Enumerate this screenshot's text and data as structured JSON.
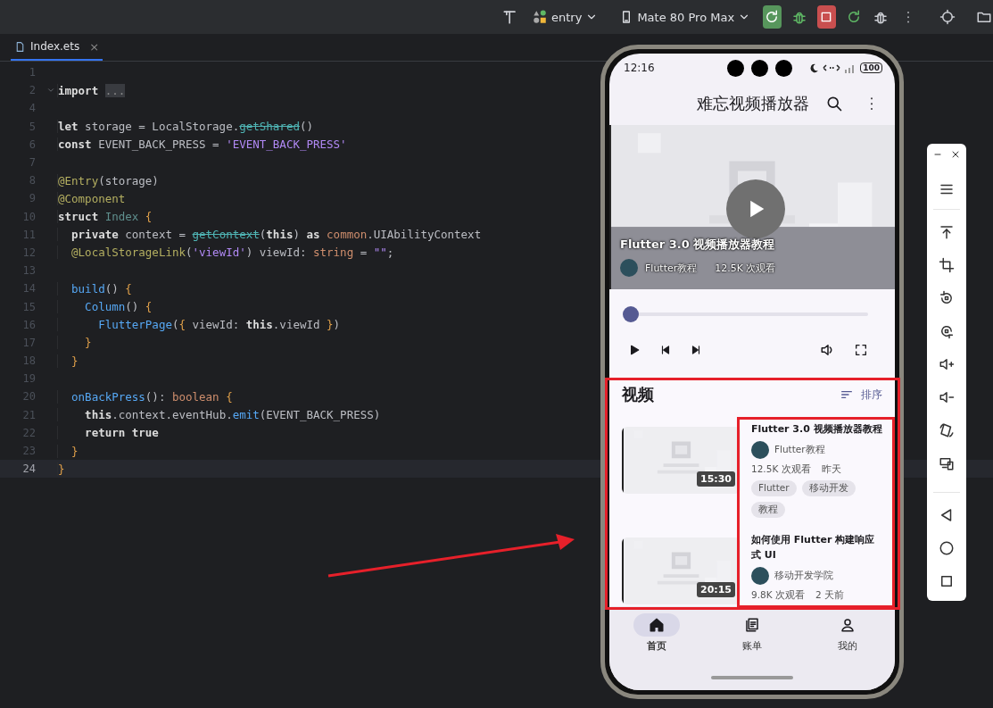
{
  "toolbar": {
    "run_config": "entry",
    "device": "Mate 80 Pro Max"
  },
  "editor_tab": {
    "label": "Index.ets",
    "close": "×"
  },
  "code_lines": [
    {
      "number": "1",
      "fold": false,
      "current": false
    },
    {
      "number": "2",
      "fold": true,
      "current": false,
      "segments": [
        {
          "kind": "kw",
          "text": "import "
        },
        {
          "kind": "folded",
          "text": "..."
        }
      ]
    },
    {
      "number": "4",
      "fold": false,
      "current": false
    },
    {
      "number": "5",
      "fold": false,
      "current": false,
      "segments": [
        {
          "kind": "kw",
          "text": "let"
        },
        {
          "kind": "plain",
          "text": " storage = LocalStorage."
        },
        {
          "kind": "deprecated",
          "text": "getShared"
        },
        {
          "kind": "plain",
          "text": "()"
        }
      ]
    },
    {
      "number": "6",
      "fold": false,
      "current": false,
      "segments": [
        {
          "kind": "kw",
          "text": "const"
        },
        {
          "kind": "plain",
          "text": " EVENT_BACK_PRESS = "
        },
        {
          "kind": "str",
          "text": "'EVENT_BACK_PRESS'"
        }
      ]
    },
    {
      "number": "7",
      "fold": false,
      "current": false
    },
    {
      "number": "8",
      "fold": false,
      "current": false,
      "segments": [
        {
          "kind": "dec",
          "text": "@Entry"
        },
        {
          "kind": "plain",
          "text": "(storage)"
        }
      ]
    },
    {
      "number": "9",
      "fold": false,
      "current": false,
      "segments": [
        {
          "kind": "dec",
          "text": "@Component"
        }
      ]
    },
    {
      "number": "10",
      "fold": false,
      "current": false,
      "segments": [
        {
          "kind": "kw",
          "text": "struct "
        },
        {
          "kind": "type",
          "text": "Index"
        },
        {
          "kind": "brace",
          "text": " {"
        }
      ]
    },
    {
      "number": "11",
      "fold": false,
      "current": false,
      "segments": [
        {
          "kind": "kw",
          "text": "  private"
        },
        {
          "kind": "plain",
          "text": " context = "
        },
        {
          "kind": "deprecated",
          "text": "getContext"
        },
        {
          "kind": "plain",
          "text": "("
        },
        {
          "kind": "kw",
          "text": "this"
        },
        {
          "kind": "plain",
          "text": ") "
        },
        {
          "kind": "kw",
          "text": "as "
        },
        {
          "kind": "type2",
          "text": "common"
        },
        {
          "kind": "plain",
          "text": ".UIAbilityContext"
        }
      ]
    },
    {
      "number": "12",
      "fold": false,
      "current": false,
      "segments": [
        {
          "kind": "dec",
          "text": "  @LocalStorageLink"
        },
        {
          "kind": "plain",
          "text": "("
        },
        {
          "kind": "str",
          "text": "'viewId'"
        },
        {
          "kind": "plain",
          "text": ") viewId: "
        },
        {
          "kind": "type2",
          "text": "string"
        },
        {
          "kind": "plain",
          "text": " = "
        },
        {
          "kind": "str",
          "text": "\"\""
        },
        {
          "kind": "plain",
          "text": ";"
        }
      ]
    },
    {
      "number": "13",
      "fold": false,
      "current": false
    },
    {
      "number": "14",
      "fold": false,
      "current": false,
      "segments": [
        {
          "kind": "func",
          "text": "  build"
        },
        {
          "kind": "plain",
          "text": "() "
        },
        {
          "kind": "brace",
          "text": "{"
        }
      ]
    },
    {
      "number": "15",
      "fold": false,
      "current": false,
      "segments": [
        {
          "kind": "func",
          "text": "    Column"
        },
        {
          "kind": "plain",
          "text": "() "
        },
        {
          "kind": "brace",
          "text": "{"
        }
      ]
    },
    {
      "number": "16",
      "fold": false,
      "current": false,
      "segments": [
        {
          "kind": "func",
          "text": "      FlutterPage"
        },
        {
          "kind": "plain",
          "text": "("
        },
        {
          "kind": "brace",
          "text": "{"
        },
        {
          "kind": "plain",
          "text": " viewId: "
        },
        {
          "kind": "kw",
          "text": "this"
        },
        {
          "kind": "plain",
          "text": ".viewId "
        },
        {
          "kind": "brace",
          "text": "}"
        },
        {
          "kind": "plain",
          "text": ")"
        }
      ]
    },
    {
      "number": "17",
      "fold": false,
      "current": false,
      "segments": [
        {
          "kind": "brace",
          "text": "    }"
        }
      ]
    },
    {
      "number": "18",
      "fold": false,
      "current": false,
      "segments": [
        {
          "kind": "brace",
          "text": "  }"
        }
      ]
    },
    {
      "number": "19",
      "fold": false,
      "current": false
    },
    {
      "number": "20",
      "fold": false,
      "current": false,
      "segments": [
        {
          "kind": "func",
          "text": "  onBackPress"
        },
        {
          "kind": "plain",
          "text": "(): "
        },
        {
          "kind": "type2",
          "text": "boolean"
        },
        {
          "kind": "brace",
          "text": " {"
        }
      ]
    },
    {
      "number": "21",
      "fold": false,
      "current": false,
      "segments": [
        {
          "kind": "kw",
          "text": "    this"
        },
        {
          "kind": "plain",
          "text": ".context.eventHub."
        },
        {
          "kind": "func",
          "text": "emit"
        },
        {
          "kind": "plain",
          "text": "(EVENT_BACK_PRESS)"
        }
      ]
    },
    {
      "number": "22",
      "fold": false,
      "current": false,
      "segments": [
        {
          "kind": "kw",
          "text": "    return true"
        }
      ]
    },
    {
      "number": "23",
      "fold": false,
      "current": false,
      "segments": [
        {
          "kind": "brace",
          "text": "  }"
        }
      ]
    },
    {
      "number": "24",
      "fold": false,
      "current": true,
      "segments": [
        {
          "kind": "brace",
          "text": "}"
        }
      ]
    }
  ],
  "emulator": {
    "status_bar": {
      "time": "12:16",
      "battery": "100"
    },
    "app_bar": {
      "title": "难忘视频播放器"
    },
    "player": {
      "overlay_title": "Flutter 3.0 视频播放器教程",
      "channel": "Flutter教程",
      "views": "12.5K 次观看",
      "level": 0
    },
    "section": {
      "title": "视频",
      "sort_label": "排序"
    },
    "videos": [
      {
        "duration": "15:30",
        "title": "Flutter 3.0 视频播放器教程",
        "channel": "Flutter教程",
        "views": "12.5K 次观看",
        "age": "昨天",
        "tags": [
          "Flutter",
          "移动开发",
          "教程"
        ]
      },
      {
        "duration": "20:15",
        "title": "如何使用 Flutter 构建响应式 UI",
        "channel": "移动开发学院",
        "views": "9.8K 次观看",
        "age": "2 天前"
      }
    ],
    "nav": [
      {
        "label": "首页",
        "selected": true
      },
      {
        "label": "账单",
        "selected": false
      },
      {
        "label": "我的",
        "selected": false
      }
    ]
  }
}
